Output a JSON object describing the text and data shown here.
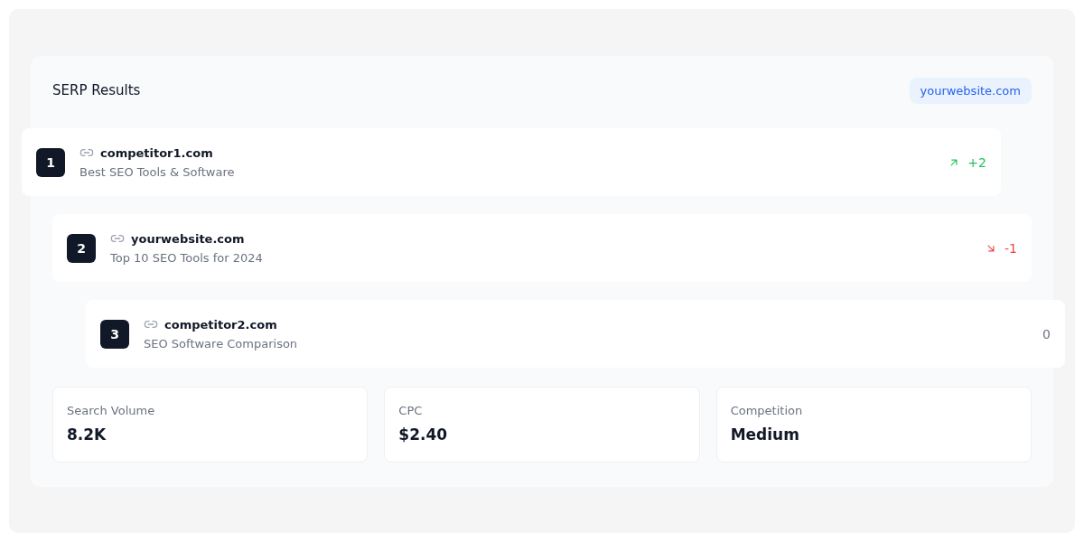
{
  "header": {
    "title": "SERP Results",
    "site_badge": "yourwebsite.com"
  },
  "results": [
    {
      "rank": "1",
      "domain": "competitor1.com",
      "title": "Best SEO Tools & Software",
      "kind": "up",
      "change": "+2"
    },
    {
      "rank": "2",
      "domain": "yourwebsite.com",
      "title": "Top 10 SEO Tools for 2024",
      "kind": "down",
      "change": "-1"
    },
    {
      "rank": "3",
      "domain": "competitor2.com",
      "title": "SEO Software Comparison",
      "kind": "flat",
      "change": "0"
    }
  ],
  "stats": [
    {
      "label": "Search Volume",
      "value": "8.2K"
    },
    {
      "label": "CPC",
      "value": "$2.40"
    },
    {
      "label": "Competition",
      "value": "Medium"
    }
  ]
}
